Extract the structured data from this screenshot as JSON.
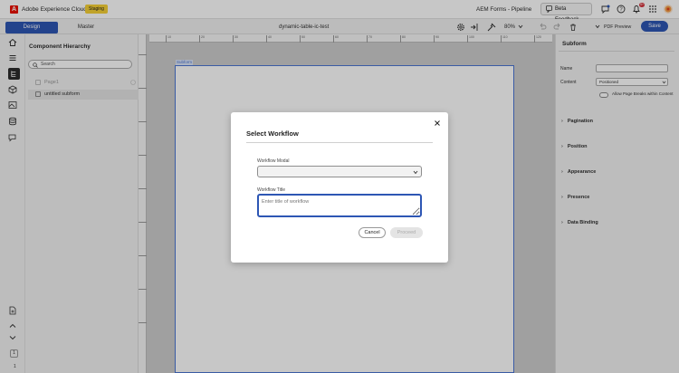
{
  "header": {
    "brand": "Adobe Experience Cloud",
    "badge": "Staging",
    "app_title": "AEM Forms - Pipeline",
    "beta_button": "Beta Feedback",
    "notification_count": "9+"
  },
  "toolbar": {
    "tabs": [
      {
        "label": "Design"
      },
      {
        "label": "Master"
      }
    ],
    "document_name": "dynamic-table-ic-test",
    "zoom": "80%",
    "pdf_preview": "PDF Preview",
    "save_label": "Save"
  },
  "left_rail": {
    "page_number": "1",
    "page_total": "1"
  },
  "component_panel": {
    "title": "Component Hierarchy",
    "search_placeholder": "Search",
    "tree": [
      {
        "label": "Page1"
      },
      {
        "label": "untitled subform"
      }
    ]
  },
  "canvas": {
    "selected_tag": "Subform",
    "ruler_labels": [
      "10",
      "20",
      "30",
      "40",
      "50",
      "60",
      "70",
      "80",
      "90",
      "100",
      "110",
      "120",
      "130"
    ]
  },
  "right_panel": {
    "title": "Subform",
    "name_label": "Name",
    "content_label": "Content",
    "content_value": "Positioned",
    "allow_breaks": "Allow Page Breaks within Content",
    "sections": [
      {
        "label": "Pagination"
      },
      {
        "label": "Position"
      },
      {
        "label": "Appearance"
      },
      {
        "label": "Presence"
      },
      {
        "label": "Data Binding"
      }
    ]
  },
  "modal": {
    "title": "Select Workflow",
    "workflow_modal_label": "Workflow Modal",
    "workflow_title_label": "Workflow Title",
    "workflow_title_placeholder": "Enter title of workflow",
    "cancel_label": "Cancel",
    "proceed_label": "Proceed"
  },
  "colors": {
    "accent": "#2d56b4",
    "badge": "#f7d137",
    "adobe_red": "#eb1000"
  }
}
